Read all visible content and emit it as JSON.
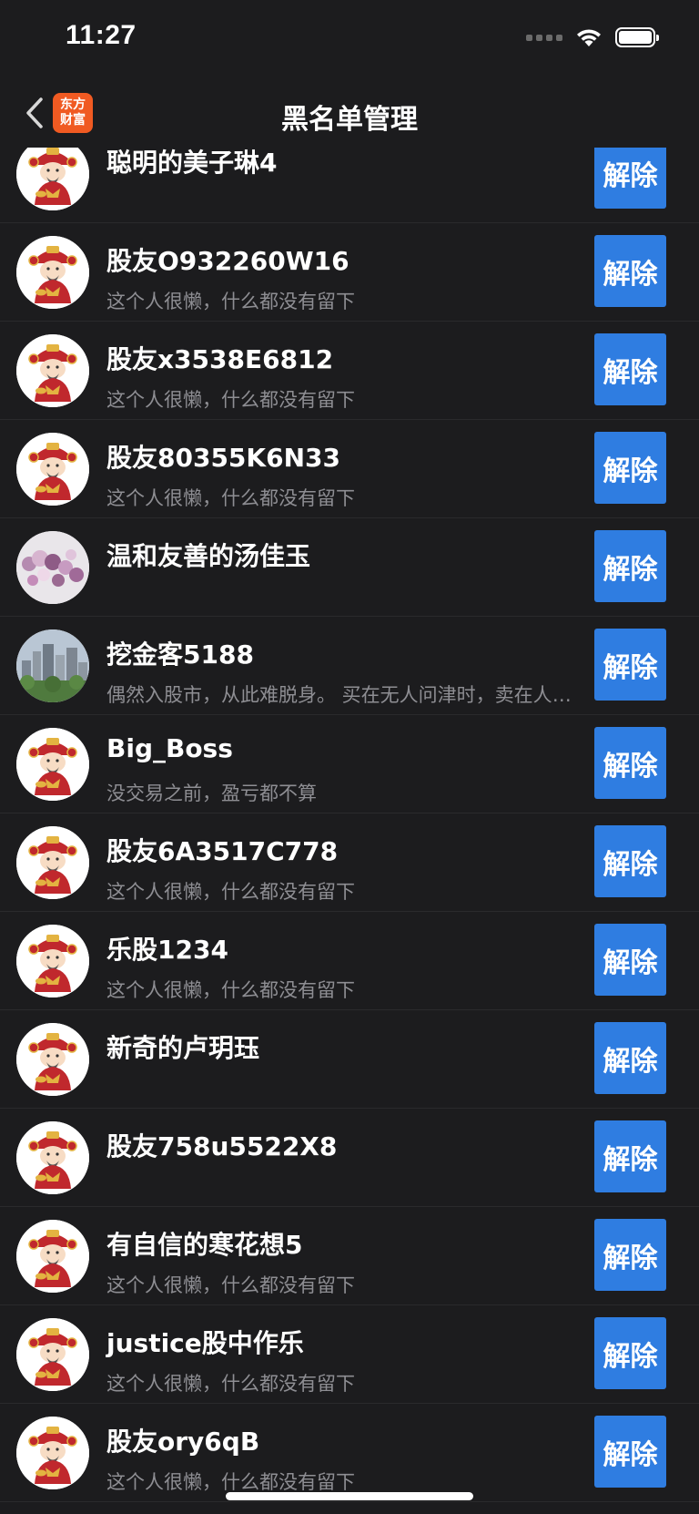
{
  "status_bar": {
    "time": "11:27"
  },
  "nav": {
    "title": "黑名单管理",
    "logo_line1": "东方",
    "logo_line2": "财富"
  },
  "colors": {
    "background": "#1c1c1e",
    "button": "#2f7de1",
    "logo": "#f05a22",
    "secondary_text": "#8e8e93"
  },
  "blocklist": [
    {
      "name": "聪明的美子琳4",
      "bio": "",
      "avatar": "fortune-god-icon",
      "button": "解除"
    },
    {
      "name": "股友O932260W16",
      "bio": "这个人很懒，什么都没有留下",
      "avatar": "fortune-god-icon",
      "button": "解除"
    },
    {
      "name": "股友x3538E6812",
      "bio": "这个人很懒，什么都没有留下",
      "avatar": "fortune-god-icon",
      "button": "解除"
    },
    {
      "name": "股友80355K6N33",
      "bio": "这个人很懒，什么都没有留下",
      "avatar": "fortune-god-icon",
      "button": "解除"
    },
    {
      "name": "温和友善的汤佳玉",
      "bio": "",
      "avatar": "crystal-beads-photo",
      "button": "解除"
    },
    {
      "name": "挖金客5188",
      "bio": "偶然入股市，从此难脱身。 买在无人问津时，卖在人声鼎沸时",
      "avatar": "city-skyline-photo",
      "button": "解除"
    },
    {
      "name": "Big_Boss",
      "bio": "没交易之前，盈亏都不算",
      "avatar": "fortune-god-icon",
      "button": "解除"
    },
    {
      "name": "股友6A3517C778",
      "bio": "这个人很懒，什么都没有留下",
      "avatar": "fortune-god-icon",
      "button": "解除"
    },
    {
      "name": "乐股1234",
      "bio": "这个人很懒，什么都没有留下",
      "avatar": "fortune-god-icon",
      "button": "解除"
    },
    {
      "name": "新奇的卢玥珏",
      "bio": "",
      "avatar": "fortune-god-icon",
      "button": "解除"
    },
    {
      "name": "股友758u5522X8",
      "bio": "",
      "avatar": "fortune-god-icon",
      "button": "解除"
    },
    {
      "name": "有自信的寒花想5",
      "bio": "这个人很懒，什么都没有留下",
      "avatar": "fortune-god-icon",
      "button": "解除"
    },
    {
      "name": "justice股中作乐",
      "bio": "这个人很懒，什么都没有留下",
      "avatar": "fortune-god-icon",
      "button": "解除"
    },
    {
      "name": "股友ory6qB",
      "bio": "这个人很懒，什么都没有留下",
      "avatar": "fortune-god-icon",
      "button": "解除"
    }
  ]
}
